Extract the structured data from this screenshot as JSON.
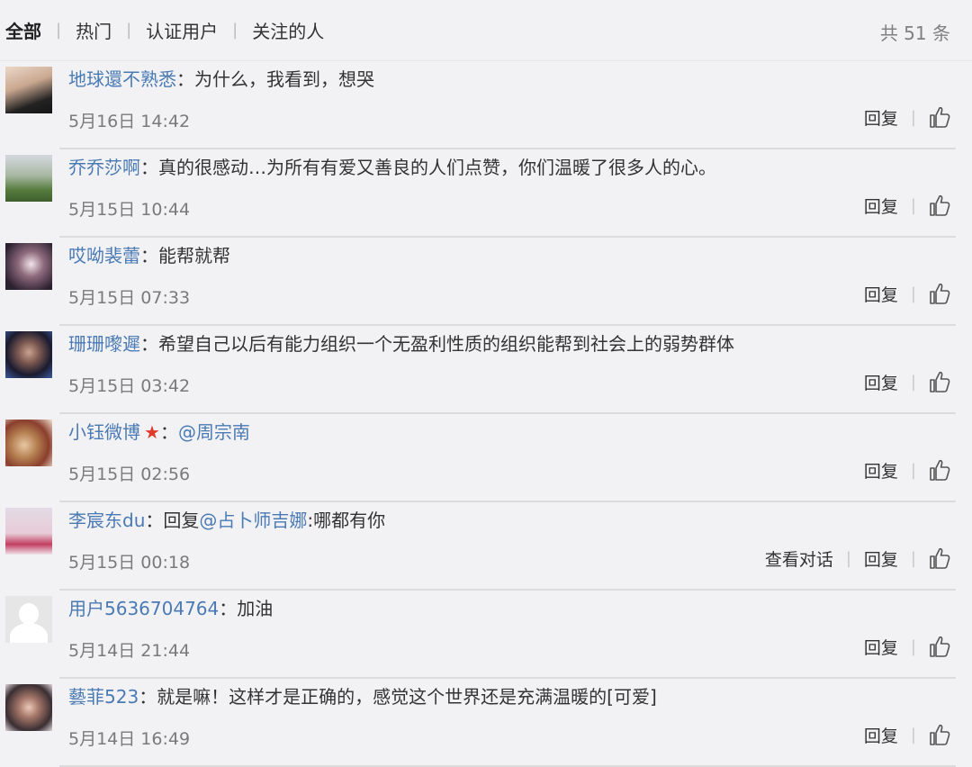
{
  "tabs": {
    "all": "全部",
    "hot": "热门",
    "verified": "认证用户",
    "following": "关注的人"
  },
  "count_label": "共 51 条",
  "actions": {
    "reply": "回复",
    "view_conversation": "查看对话"
  },
  "comments": [
    {
      "user": "地球還不熟悉",
      "colon": "：",
      "text": "为什么，我看到，想哭",
      "time": "5月16日 14:42"
    },
    {
      "user": "乔乔莎啊",
      "colon": "：",
      "text": "真的很感动…为所有有爱又善良的人们点赞，你们温暖了很多人的心。",
      "time": "5月15日 10:44"
    },
    {
      "user": "哎呦裴蕾",
      "colon": "：",
      "text": "能帮就帮",
      "time": "5月15日 07:33"
    },
    {
      "user": "珊珊嚟遲",
      "colon": "：",
      "text": "希望自己以后有能力组织一个无盈利性质的组织能帮到社会上的弱势群体",
      "time": "5月15日 03:42"
    },
    {
      "user": "小钰微博",
      "colon": "：",
      "mention": "@周宗南",
      "time": "5月15日 02:56"
    },
    {
      "user": "李宸东du",
      "colon": "：",
      "text_before": "回复",
      "mention": "@占卜师吉娜",
      "text_after": ":哪都有你",
      "time": "5月15日 00:18"
    },
    {
      "user": "用户5636704764",
      "colon": "：",
      "text": "加油",
      "time": "5月14日 21:44"
    },
    {
      "user": "藝菲523",
      "colon": "：",
      "text": "就是嘛！这样才是正确的，感觉这个世界还是充满温暖的[可爱]",
      "time": "5月14日 16:49"
    }
  ]
}
